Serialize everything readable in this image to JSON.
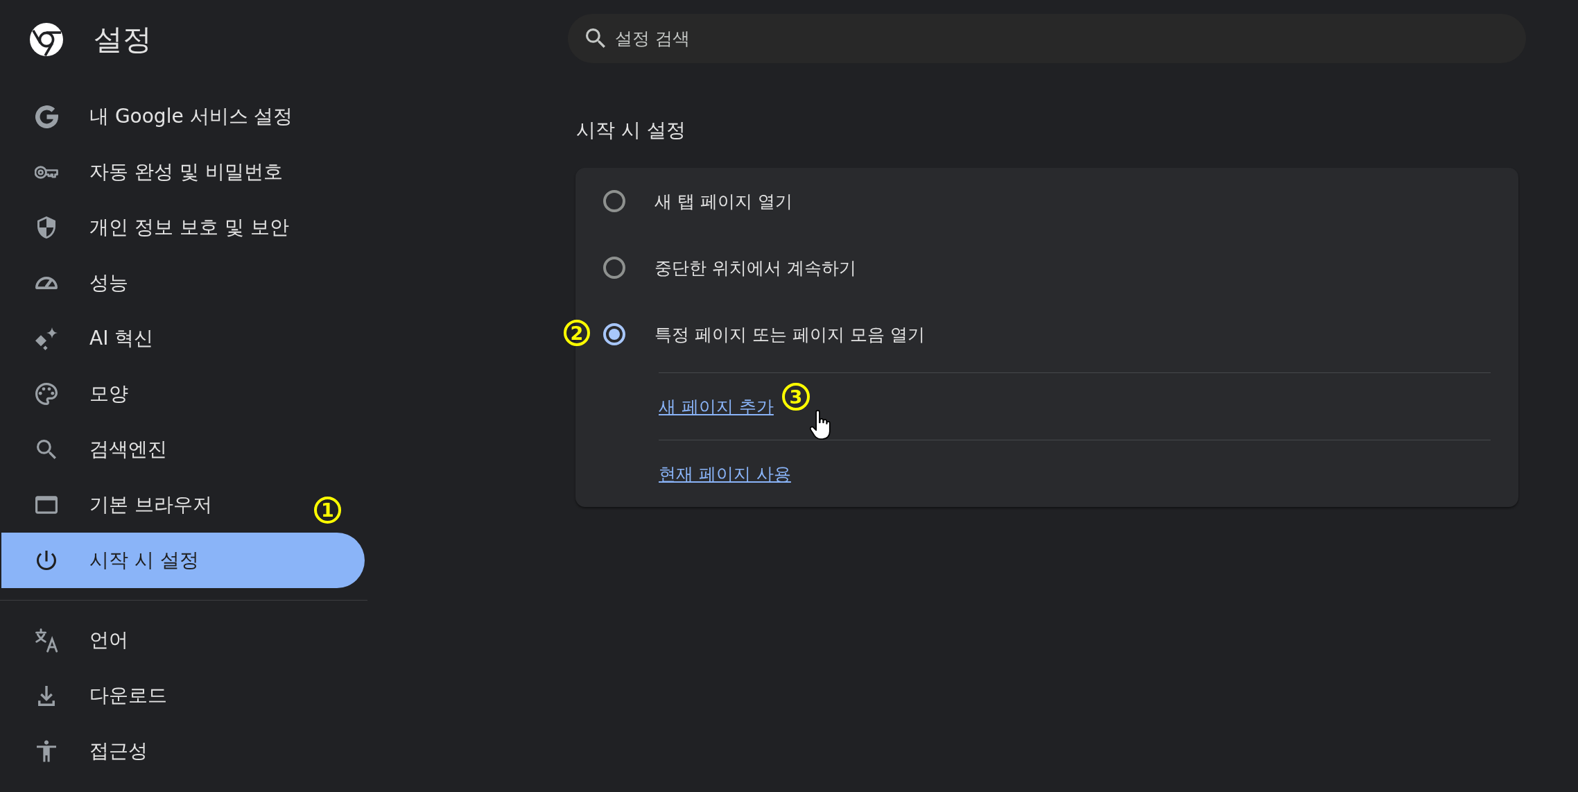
{
  "header": {
    "title": "설정"
  },
  "search": {
    "placeholder": "설정 검색"
  },
  "sidebar": {
    "groups": [
      {
        "items": [
          {
            "label": "내 Google 서비스 설정",
            "selected": false
          },
          {
            "label": "자동 완성 및 비밀번호",
            "selected": false
          },
          {
            "label": "개인 정보 보호 및 보안",
            "selected": false
          },
          {
            "label": "성능",
            "selected": false
          },
          {
            "label": "AI 혁신",
            "selected": false
          },
          {
            "label": "모양",
            "selected": false
          },
          {
            "label": "검색엔진",
            "selected": false
          },
          {
            "label": "기본 브라우저",
            "selected": false
          },
          {
            "label": "시작 시 설정",
            "selected": true
          }
        ]
      },
      {
        "items": [
          {
            "label": "언어",
            "selected": false
          },
          {
            "label": "다운로드",
            "selected": false
          },
          {
            "label": "접근성",
            "selected": false
          }
        ]
      }
    ]
  },
  "section": {
    "title": "시작 시 설정",
    "options": [
      {
        "label": "새 탭 페이지 열기",
        "selected": false
      },
      {
        "label": "중단한 위치에서 계속하기",
        "selected": false
      },
      {
        "label": "특정 페이지 또는 페이지 모음 열기",
        "selected": true
      }
    ],
    "page_actions": [
      {
        "label": "새 페이지 추가"
      },
      {
        "label": "현재 페이지 사용"
      }
    ]
  },
  "callouts": [
    {
      "label": "1"
    },
    {
      "label": "2"
    },
    {
      "label": "3"
    }
  ]
}
